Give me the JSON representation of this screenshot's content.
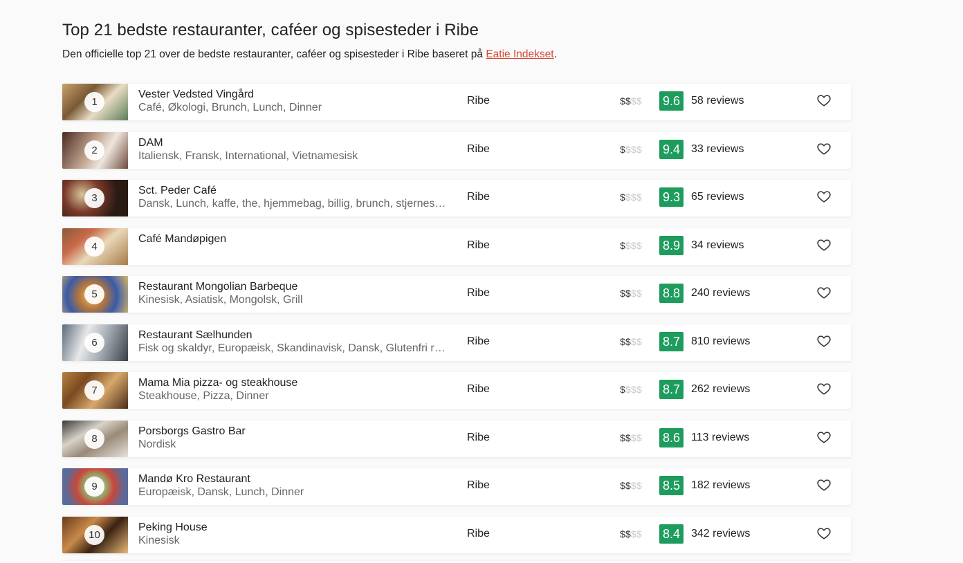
{
  "header": {
    "title": "Top 21 bedste restauranter, caféer og spisesteder i Ribe",
    "subtitle_prefix": "Den officielle top 21 over de bedste restauranter, caféer og spisesteder i Ribe baseret på ",
    "subtitle_link": "Eatie Indekset",
    "subtitle_suffix": "."
  },
  "colors": {
    "score_badge": "#1e9c5e",
    "link": "#d44a36",
    "price_active": "#333333",
    "price_inactive": "#c8c8c8"
  },
  "restaurants": [
    {
      "rank": "1",
      "name": "Vester Vedsted Vingård",
      "tags": "Café, Økologi, Brunch, Lunch, Dinner",
      "city": "Ribe",
      "price_on": "$$",
      "price_off": "$$",
      "score": "9.6",
      "reviews": "58 reviews"
    },
    {
      "rank": "2",
      "name": "DAM",
      "tags": "Italiensk, Fransk, International, Vietnamesisk",
      "city": "Ribe",
      "price_on": "$",
      "price_off": "$$$",
      "score": "9.4",
      "reviews": "33 reviews"
    },
    {
      "rank": "3",
      "name": "Sct. Peder Café",
      "tags": "Dansk, Lunch, kaffe, the, hjemmebag, billig, brunch, stjernes…",
      "city": "Ribe",
      "price_on": "$",
      "price_off": "$$$",
      "score": "9.3",
      "reviews": "65 reviews"
    },
    {
      "rank": "4",
      "name": "Café Mandøpigen",
      "tags": "",
      "city": "Ribe",
      "price_on": "$",
      "price_off": "$$$",
      "score": "8.9",
      "reviews": "34 reviews"
    },
    {
      "rank": "5",
      "name": "Restaurant Mongolian Barbeque",
      "tags": "Kinesisk, Asiatisk, Mongolsk, Grill",
      "city": "Ribe",
      "price_on": "$$",
      "price_off": "$$",
      "score": "8.8",
      "reviews": "240 reviews"
    },
    {
      "rank": "6",
      "name": "Restaurant Sælhunden",
      "tags": "Fisk og skaldyr, Europæisk, Skandinavisk, Dansk, Glutenfri r…",
      "city": "Ribe",
      "price_on": "$$",
      "price_off": "$$",
      "score": "8.7",
      "reviews": "810 reviews"
    },
    {
      "rank": "7",
      "name": "Mama Mia pizza- og steakhouse",
      "tags": "Steakhouse, Pizza, Dinner",
      "city": "Ribe",
      "price_on": "$",
      "price_off": "$$$",
      "score": "8.7",
      "reviews": "262 reviews"
    },
    {
      "rank": "8",
      "name": "Porsborgs Gastro Bar",
      "tags": "Nordisk",
      "city": "Ribe",
      "price_on": "$$",
      "price_off": "$$",
      "score": "8.6",
      "reviews": "113 reviews"
    },
    {
      "rank": "9",
      "name": "Mandø Kro Restaurant",
      "tags": "Europæisk, Dansk, Lunch, Dinner",
      "city": "Ribe",
      "price_on": "$$",
      "price_off": "$$",
      "score": "8.5",
      "reviews": "182 reviews"
    },
    {
      "rank": "10",
      "name": "Peking House",
      "tags": "Kinesisk",
      "city": "Ribe",
      "price_on": "$$",
      "price_off": "$$",
      "score": "8.4",
      "reviews": "342 reviews"
    }
  ]
}
